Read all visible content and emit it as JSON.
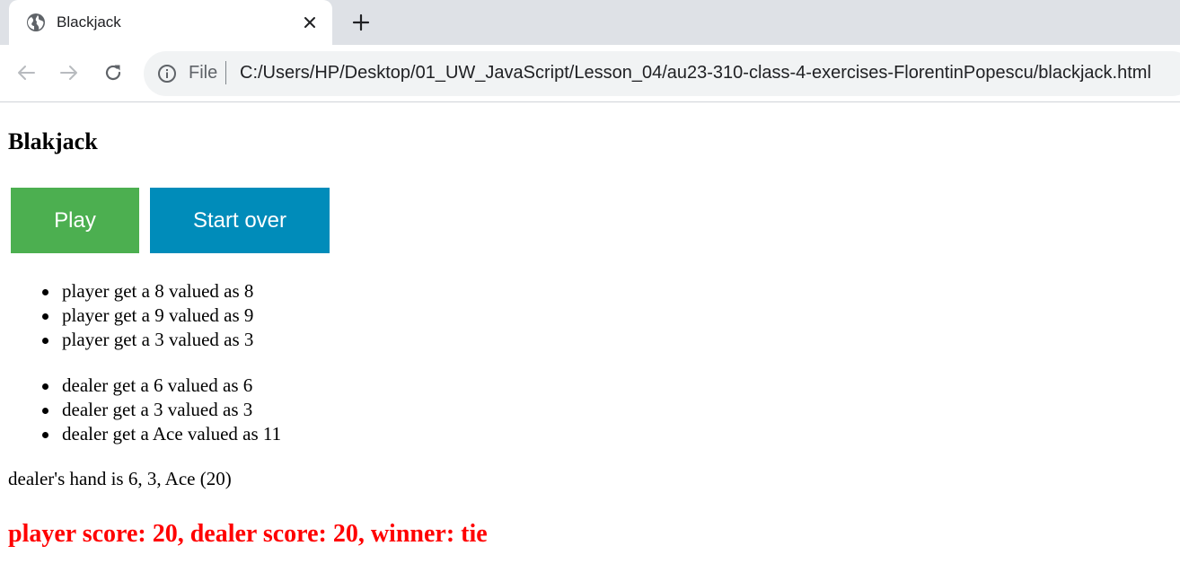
{
  "browser": {
    "tab": {
      "title": "Blackjack",
      "favicon": "globe-icon",
      "close_icon": "close-icon"
    },
    "new_tab_icon": "plus-icon",
    "nav": {
      "back_icon": "arrow-left-icon",
      "forward_icon": "arrow-right-icon",
      "reload_icon": "reload-icon"
    },
    "address_bar": {
      "info_icon": "info-icon",
      "scheme_label": "File",
      "url": "C:/Users/HP/Desktop/01_UW_JavaScript/Lesson_04/au23-310-class-4-exercises-FlorentinPopescu/blackjack.html"
    }
  },
  "page": {
    "title": "Blakjack",
    "buttons": {
      "play": "Play",
      "start_over": "Start over"
    },
    "player_cards": [
      "player get a 8 valued as 8",
      "player get a 9 valued as 9",
      "player get a 3 valued as 3"
    ],
    "dealer_cards": [
      "dealer get a 6 valued as 6",
      "dealer get a 3 valued as 3",
      "dealer get a Ace valued as 11"
    ],
    "dealer_hand": "dealer's hand is 6, 3, Ace (20)",
    "result": "player score: 20, dealer score: 20, winner: tie"
  },
  "colors": {
    "play_button": "#4caf50",
    "start_over_button": "#008cba",
    "result_text": "#ff0000",
    "tabstrip": "#dee1e6",
    "omnibox": "#f1f3f4"
  }
}
